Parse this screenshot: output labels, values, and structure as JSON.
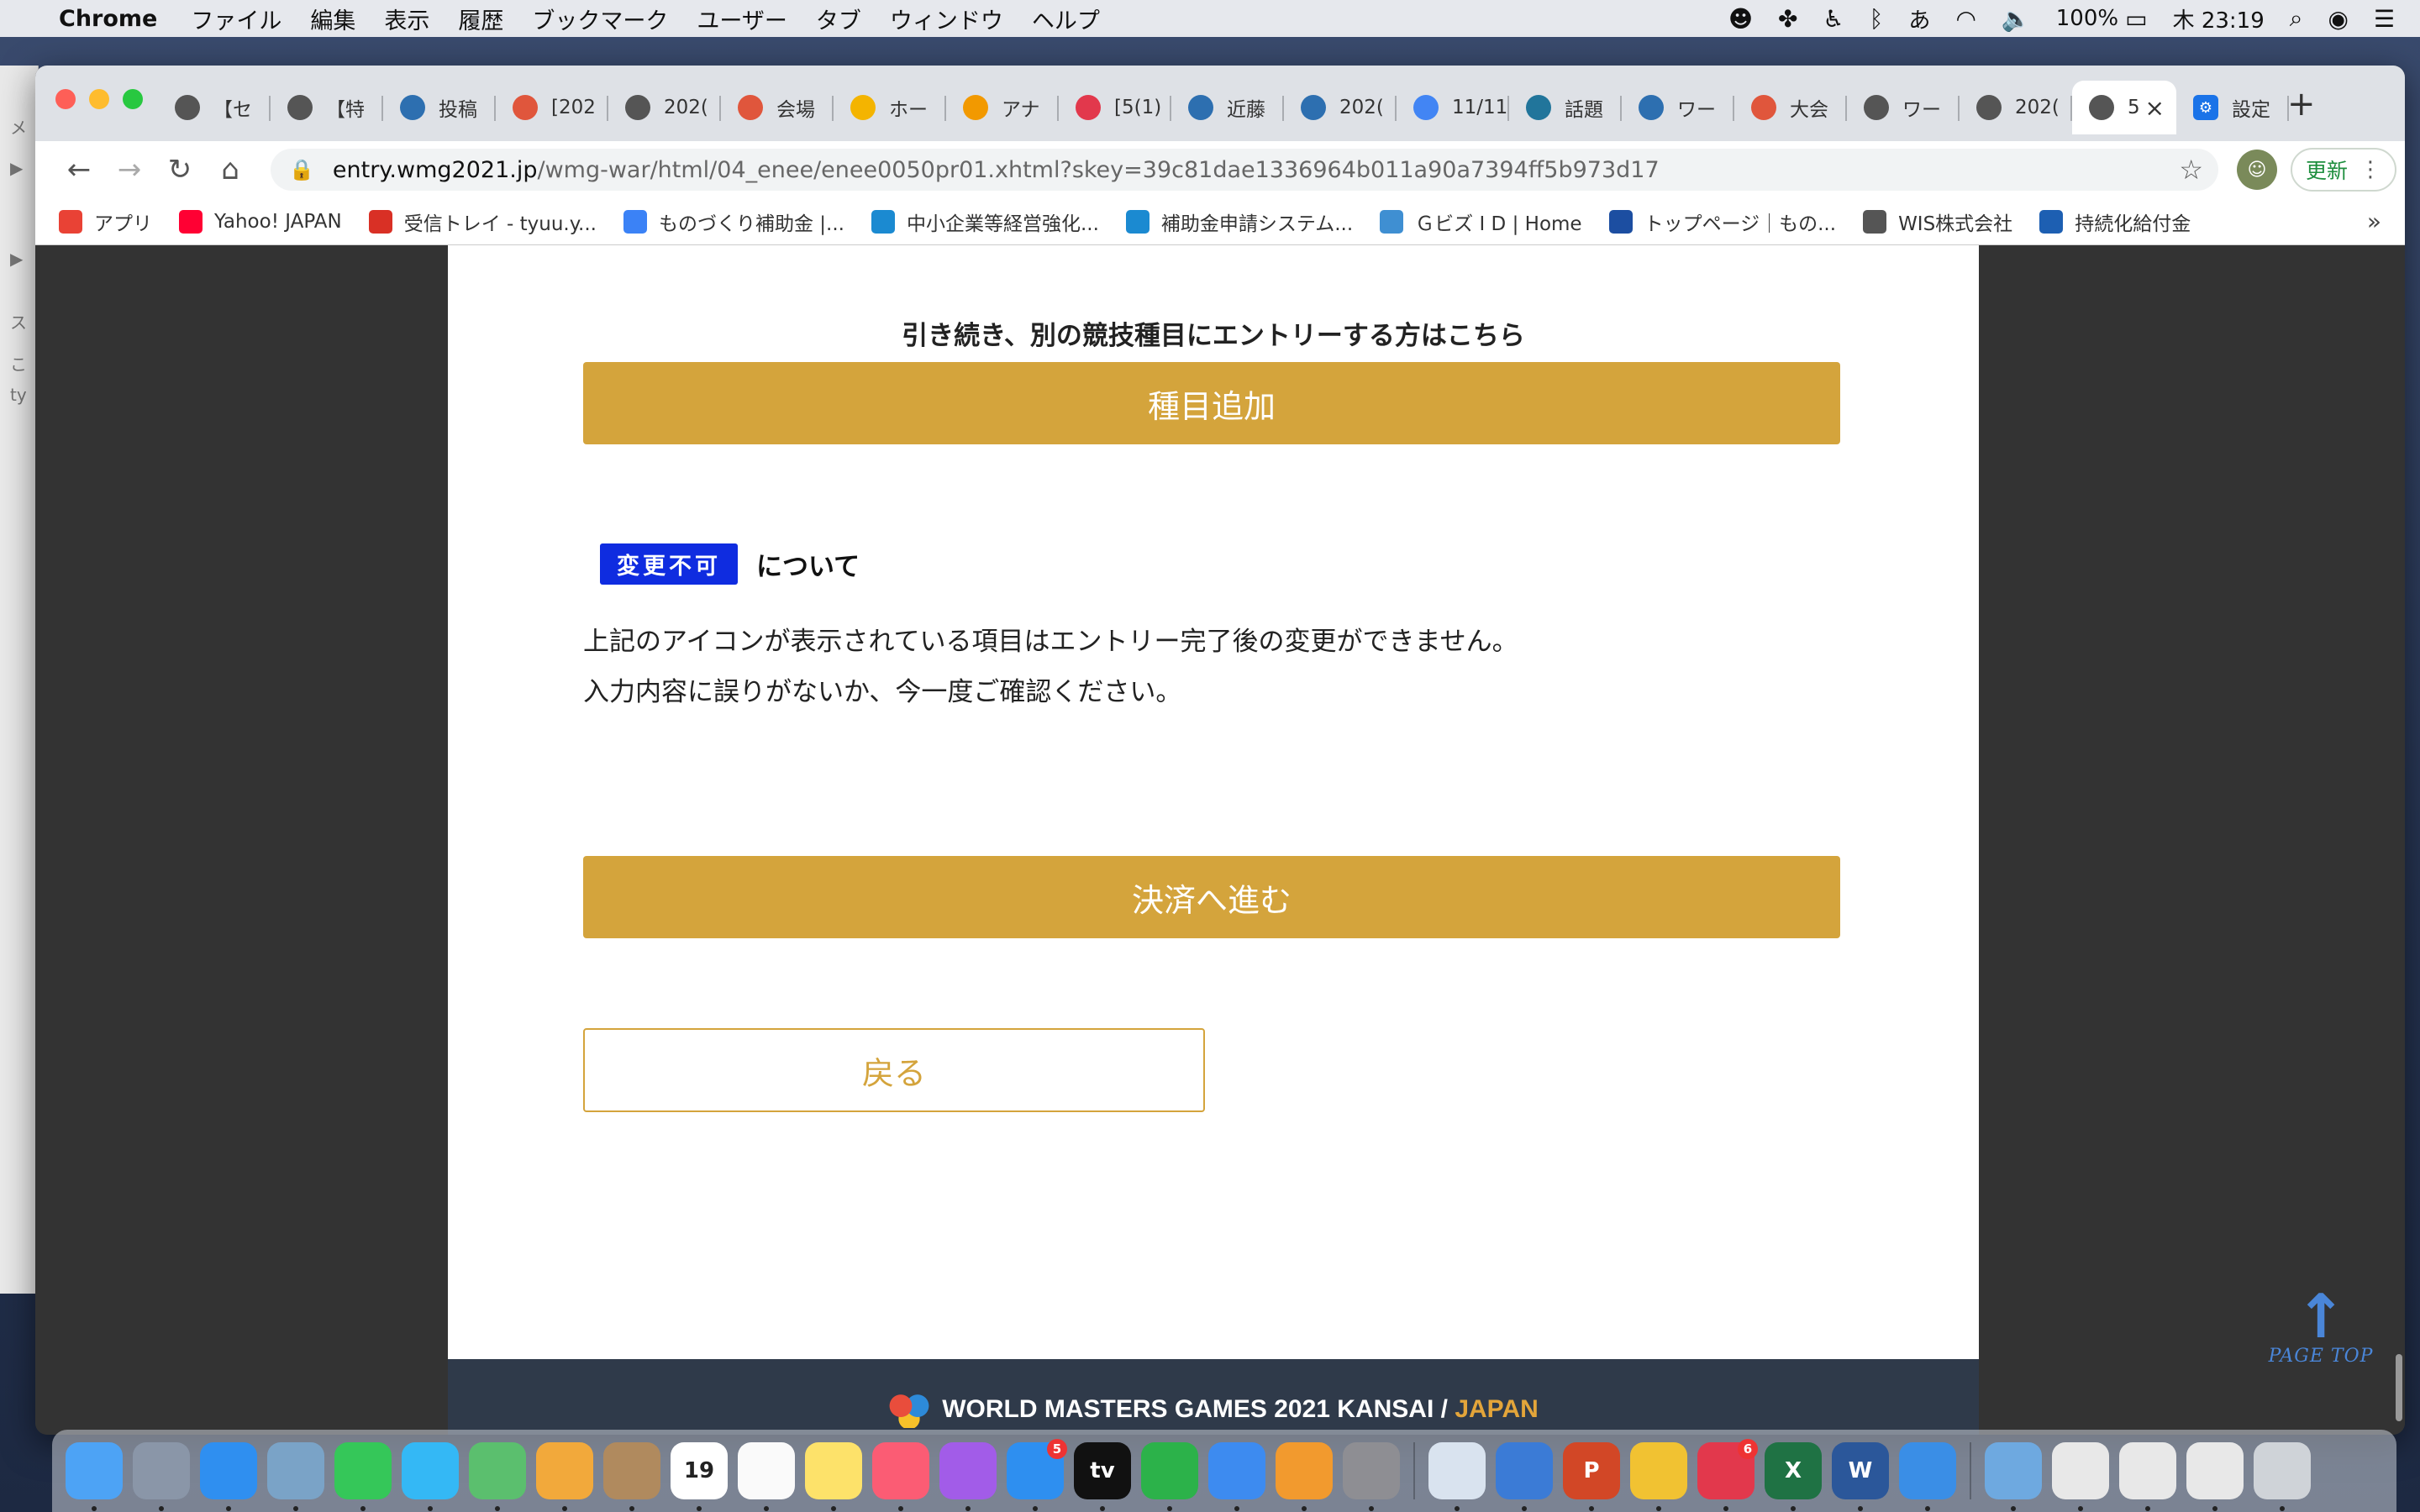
{
  "menubar": {
    "apple": "",
    "app": "Chrome",
    "items": [
      "ファイル",
      "編集",
      "表示",
      "履歴",
      "ブックマーク",
      "ユーザー",
      "タブ",
      "ウィンドウ",
      "ヘルプ"
    ],
    "battery": "100%",
    "clock": "木 23:19",
    "input_method": "あ"
  },
  "tabs": [
    {
      "label": "【セ",
      "icon": "globe-icon",
      "color": "#555"
    },
    {
      "label": "【特",
      "icon": "globe-icon",
      "color": "#555"
    },
    {
      "label": "投稿",
      "icon": "page-icon",
      "color": "#2d6fb0"
    },
    {
      "label": "[202",
      "icon": "flower-icon",
      "color": "#e0563c"
    },
    {
      "label": "202(",
      "icon": "globe-icon",
      "color": "#555"
    },
    {
      "label": "会場",
      "icon": "flower-icon",
      "color": "#e0563c"
    },
    {
      "label": "ホー",
      "icon": "ads-icon",
      "color": "#f4b400"
    },
    {
      "label": "アナ",
      "icon": "analytics-icon",
      "color": "#f29900"
    },
    {
      "label": "[5(1)",
      "icon": "flower-icon",
      "color": "#e2384c"
    },
    {
      "label": "近藤",
      "icon": "page-icon",
      "color": "#2d6fb0"
    },
    {
      "label": "202(",
      "icon": "page-icon",
      "color": "#2d6fb0"
    },
    {
      "label": "11/11",
      "icon": "docs-icon",
      "color": "#4285f4"
    },
    {
      "label": "話題",
      "icon": "wordpress-icon",
      "color": "#21759b"
    },
    {
      "label": "ワー",
      "icon": "page-icon",
      "color": "#2d6fb0"
    },
    {
      "label": "大会",
      "icon": "flower-icon",
      "color": "#e0563c"
    },
    {
      "label": "ワー",
      "icon": "globe-icon",
      "color": "#555"
    },
    {
      "label": "202(",
      "icon": "globe-icon",
      "color": "#555"
    },
    {
      "label": "5",
      "icon": "globe-icon",
      "color": "#555",
      "active": true
    },
    {
      "label": "設定",
      "icon": "gear-icon",
      "color": "#1a73e8"
    }
  ],
  "omnibox": {
    "host": "entry.wmg2021.jp",
    "path": "/wmg-war/html/04_enee/enee0050pr01.xhtml?skey=39c81dae1336964b011a90a7394ff5b973d17"
  },
  "update_label": "更新",
  "bookmarks": [
    {
      "label": "アプリ",
      "icon": "apps-grid-icon",
      "color": "#e94235"
    },
    {
      "label": "Yahoo! JAPAN",
      "icon": "yahoo-icon",
      "color": "#ff0033"
    },
    {
      "label": "受信トレイ - tyuu.y...",
      "icon": "gmail-icon",
      "color": "#d93025"
    },
    {
      "label": "ものづくり補助金 |...",
      "icon": "ai-icon",
      "color": "#3b82f6"
    },
    {
      "label": "中小企業等経営強化...",
      "icon": "s-logo-icon",
      "color": "#1b8ad1"
    },
    {
      "label": "補助金申請システム...",
      "icon": "s-logo-icon",
      "color": "#1b8ad1"
    },
    {
      "label": "Ｇビズ I D | Home",
      "icon": "gbiz-icon",
      "color": "#3f8fd2"
    },
    {
      "label": "トップページ｜もの...",
      "icon": "mo-icon",
      "color": "#1c4ea1"
    },
    {
      "label": "WIS株式会社",
      "icon": "globe-icon",
      "color": "#555"
    },
    {
      "label": "持続化給付金",
      "icon": "square-icon",
      "color": "#1d5fb2"
    }
  ],
  "page": {
    "add_note": "引き続き、別の競技種目にエントリーする方はこちら",
    "add_button": "種目追加",
    "badge": "変更不可",
    "badge_suffix": "について",
    "notice_line1": "上記のアイコンが表示されている項目はエントリー完了後の変更ができません。",
    "notice_line2": "入力内容に誤りがないか、今一度ご確認ください。",
    "pay_button": "決済へ進む",
    "back_button": "戻る",
    "footer_logo": "WORLD MASTERS GAMES 2021 KANSAI /",
    "footer_logo_jp": "JAPAN",
    "page_top": "PAGE TOP"
  },
  "colors": {
    "gold": "#d4a43c",
    "badge_blue": "#0f2ce0",
    "link_blue": "#4a86d8"
  },
  "dock": [
    {
      "name": "finder",
      "color": "#4da3f5"
    },
    {
      "name": "launchpad",
      "color": "#8a96a8"
    },
    {
      "name": "safari",
      "color": "#2f8ff0"
    },
    {
      "name": "mail-stamp",
      "color": "#7aa3c7"
    },
    {
      "name": "facetime",
      "color": "#35c759"
    },
    {
      "name": "messages",
      "color": "#34b8f5"
    },
    {
      "name": "maps",
      "color": "#5bbf6e"
    },
    {
      "name": "photos",
      "color": "#f2a93b"
    },
    {
      "name": "contacts",
      "color": "#b08a5e"
    },
    {
      "name": "calendar",
      "color": "#ffffff",
      "text": "19"
    },
    {
      "name": "reminders",
      "color": "#fafafa"
    },
    {
      "name": "notes",
      "color": "#fde26a"
    },
    {
      "name": "music",
      "color": "#fb5c74"
    },
    {
      "name": "podcasts",
      "color": "#a25ce8"
    },
    {
      "name": "app-store",
      "color": "#2e8ff0",
      "badge": "5"
    },
    {
      "name": "apple-tv",
      "color": "#111111",
      "text": "tv"
    },
    {
      "name": "numbers",
      "color": "#2cb24a"
    },
    {
      "name": "keynote",
      "color": "#3d8bf0"
    },
    {
      "name": "pages",
      "color": "#f29a2e"
    },
    {
      "name": "system-preferences",
      "color": "#8e8e93"
    },
    {
      "name": "sep"
    },
    {
      "name": "finder-face",
      "color": "#d9e3ef"
    },
    {
      "name": "preview",
      "color": "#3b7bd6"
    },
    {
      "name": "powerpoint",
      "color": "#d24726",
      "text": "P"
    },
    {
      "name": "chrome",
      "color": "#f1c232"
    },
    {
      "name": "sketch-flower",
      "color": "#e2384c",
      "badge": "6"
    },
    {
      "name": "excel",
      "color": "#1f7244",
      "text": "X"
    },
    {
      "name": "word",
      "color": "#2b579a",
      "text": "W"
    },
    {
      "name": "bluetooth",
      "color": "#3a8ee6"
    },
    {
      "name": "sep"
    },
    {
      "name": "downloads",
      "color": "#6ea9e0"
    },
    {
      "name": "doc-stack",
      "color": "#e8e8e8"
    },
    {
      "name": "doc-stack",
      "color": "#e8e8e8"
    },
    {
      "name": "doc-stack",
      "color": "#e8e8e8"
    },
    {
      "name": "trash",
      "color": "#cfd3d8"
    }
  ]
}
